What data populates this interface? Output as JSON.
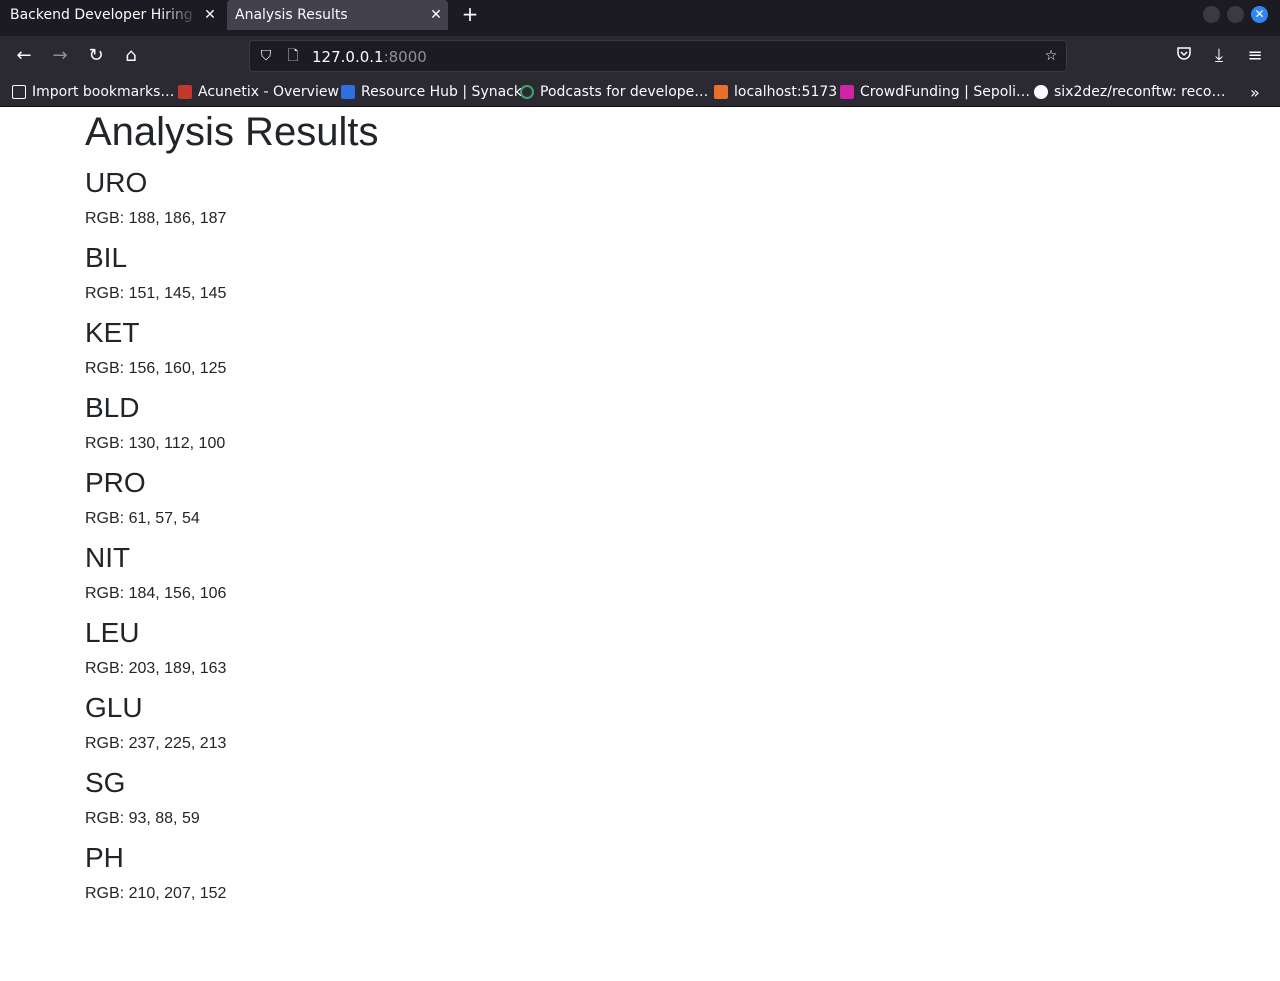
{
  "browser": {
    "tabs": [
      {
        "title": "Backend Developer Hiring Assignment",
        "active": false
      },
      {
        "title": "Analysis Results",
        "active": true
      }
    ],
    "url": {
      "host": "127.0.0.1",
      "port": ":8000"
    },
    "bookmarks": [
      {
        "label": "Import bookmarks…",
        "icon": "import-icon"
      },
      {
        "label": "Acunetix - Overview",
        "icon": "acunetix-icon"
      },
      {
        "label": "Resource Hub | Synack",
        "icon": "synack-icon"
      },
      {
        "label": "Podcasts for develope…",
        "icon": "podcast-icon"
      },
      {
        "label": "localhost:5173",
        "icon": "localhost-icon"
      },
      {
        "label": "CrowdFunding | Sepoli…",
        "icon": "crowdfunding-icon"
      },
      {
        "label": "six2dez/reconftw: reco…",
        "icon": "github-icon"
      }
    ],
    "colors": {
      "tabbar": "#1c1b22",
      "toolbar": "#2b2a33",
      "accent": "#2f86f6"
    }
  },
  "page": {
    "title": "Analysis Results",
    "results": [
      {
        "name": "URO",
        "rgb": "RGB: 188, 186, 187"
      },
      {
        "name": "BIL",
        "rgb": "RGB: 151, 145, 145"
      },
      {
        "name": "KET",
        "rgb": "RGB: 156, 160, 125"
      },
      {
        "name": "BLD",
        "rgb": "RGB: 130, 112, 100"
      },
      {
        "name": "PRO",
        "rgb": "RGB: 61, 57, 54"
      },
      {
        "name": "NIT",
        "rgb": "RGB: 184, 156, 106"
      },
      {
        "name": "LEU",
        "rgb": "RGB: 203, 189, 163"
      },
      {
        "name": "GLU",
        "rgb": "RGB: 237, 225, 213"
      },
      {
        "name": "SG",
        "rgb": "RGB: 93, 88, 59"
      },
      {
        "name": "PH",
        "rgb": "RGB: 210, 207, 152"
      }
    ]
  }
}
